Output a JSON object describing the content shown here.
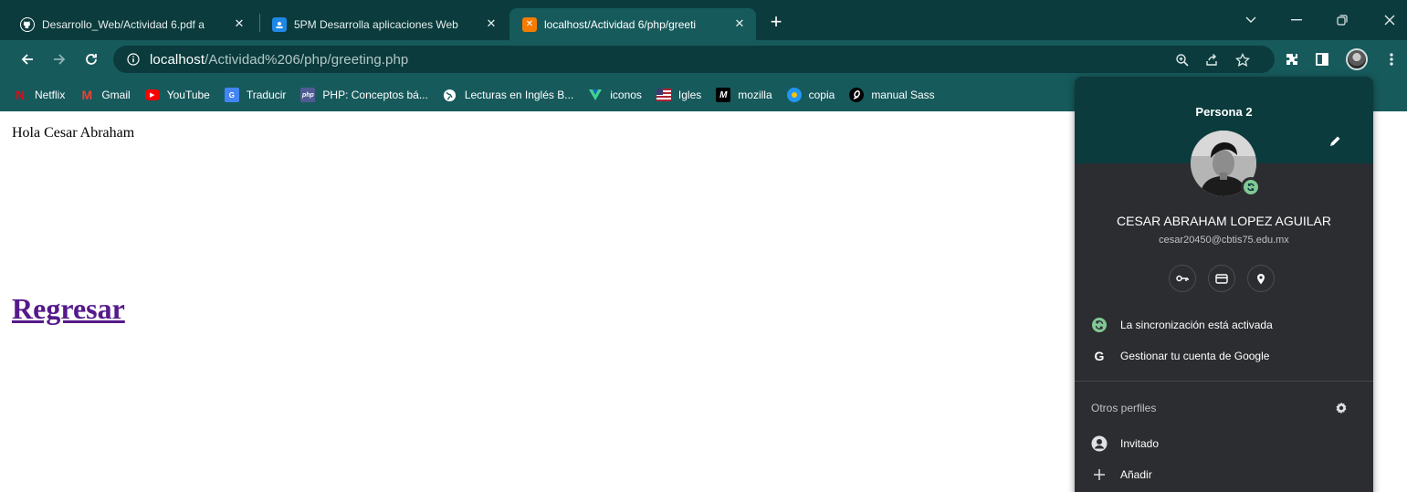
{
  "tabs": [
    {
      "title": "Desarrollo_Web/Actividad 6.pdf a",
      "icon": "github-icon"
    },
    {
      "title": "5PM Desarrolla aplicaciones Web",
      "icon": "classroom-icon"
    },
    {
      "title": "localhost/Actividad 6/php/greeti",
      "icon": "xampp-icon",
      "active": true
    }
  ],
  "toolbar": {
    "url_host": "localhost",
    "url_path": "/Actividad%206/php/greeting.php"
  },
  "bookmarks": [
    {
      "label": "Netflix",
      "icon": "netflix-icon"
    },
    {
      "label": "Gmail",
      "icon": "gmail-icon"
    },
    {
      "label": "YouTube",
      "icon": "youtube-icon"
    },
    {
      "label": "Traducir",
      "icon": "translate-icon"
    },
    {
      "label": "PHP: Conceptos bá...",
      "icon": "php-icon"
    },
    {
      "label": "Lecturas en Inglés B...",
      "icon": "globe-icon"
    },
    {
      "label": "iconos",
      "icon": "vuetify-icon"
    },
    {
      "label": "Igles",
      "icon": "flag-icon"
    },
    {
      "label": "mozilla",
      "icon": "mozilla-icon"
    },
    {
      "label": "copia",
      "icon": "copia-icon"
    },
    {
      "label": "manual Sass",
      "icon": "sass-icon"
    }
  ],
  "page": {
    "greeting": "Hola Cesar Abraham",
    "back_link": "Regresar"
  },
  "profile": {
    "profile_name": "Persona 2",
    "full_name": "CESAR ABRAHAM LOPEZ AGUILAR",
    "email": "cesar20450@cbtis75.edu.mx",
    "sync_status": "La sincronización está activada",
    "manage_account": "Gestionar tu cuenta de Google",
    "other_profiles": "Otros perfiles",
    "guest": "Invitado",
    "add": "Añadir"
  },
  "colors": {
    "frame_dark": "#0b3b3d",
    "frame": "#175a5c",
    "popup_bg": "#2b2d30",
    "sync_green": "#81c995",
    "visited_link": "#551a8b"
  }
}
